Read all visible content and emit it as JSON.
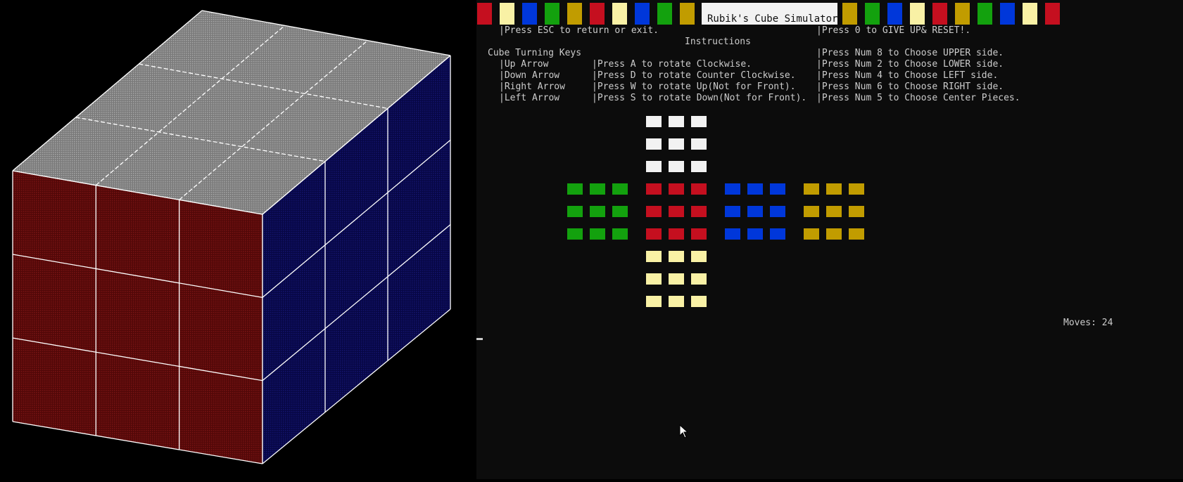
{
  "console": {
    "title": "Rubik's Cube Simulator",
    "bars_left": [
      "red",
      "yellow",
      "blue",
      "green",
      "gold",
      "red",
      "yellow",
      "blue",
      "green",
      "gold"
    ],
    "bars_right": [
      "gold",
      "green",
      "blue",
      "yellow",
      "red",
      "gold",
      "green",
      "blue",
      "yellow",
      "red"
    ],
    "lines": {
      "esc": "|Press ESC to return or exit.",
      "giveup": "|Press 0 to GIVE UP& RESET!.",
      "instructions": "Instructions",
      "turning_keys": "Cube Turning Keys",
      "k1": "|Up Arrow",
      "k2": "|Down Arrow",
      "k3": "|Right Arrow",
      "k4": "|Left Arrow",
      "r1": "|Press A to rotate Clockwise.",
      "r2": "|Press D to rotate Counter Clockwise.",
      "r3": "|Press W to rotate Up(Not for Front).",
      "r4": "|Press S to rotate Down(Not for Front).",
      "n1": "|Press Num 8 to Choose UPPER side.",
      "n2": "|Press Num 2 to Choose LOWER side.",
      "n3": "|Press Num 4 to Choose LEFT side.",
      "n4": "|Press Num 6 to Choose RIGHT side.",
      "n5": "|Press Num 5 to Choose Center Pieces."
    },
    "moves": "Moves: 24",
    "net": {
      "up": "white",
      "left": "green",
      "front": "red",
      "right": "blue",
      "back": "gold",
      "down": "yellow"
    }
  },
  "cube3d": {
    "top": "white",
    "front": "red",
    "right": "blue"
  },
  "colors": {
    "red": "#c50f1f",
    "yellow": "#f9f1a5",
    "blue": "#0037da",
    "green": "#13a10e",
    "gold": "#c19c00",
    "white": "#f2f2f2",
    "console_text": "#cccccc",
    "console_bg": "#0c0c0c",
    "cube_top": "#8c8c8c",
    "cube_front": "#5a0a0a",
    "cube_right": "#0a0a55"
  }
}
